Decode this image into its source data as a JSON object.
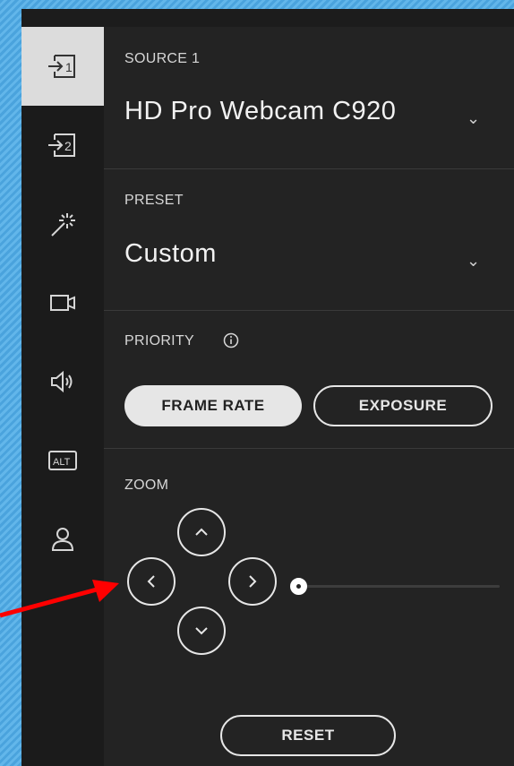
{
  "sidebar": {
    "items": [
      {
        "icon": "source-1-icon",
        "active": true,
        "text": "1"
      },
      {
        "icon": "source-2-icon",
        "active": false,
        "text": "2"
      },
      {
        "icon": "magic-wand-icon",
        "active": false
      },
      {
        "icon": "camera-icon",
        "active": false
      },
      {
        "icon": "speaker-icon",
        "active": false
      },
      {
        "icon": "alt-icon",
        "active": false,
        "text": "ALT"
      },
      {
        "icon": "user-icon",
        "active": false
      }
    ]
  },
  "source": {
    "label": "SOURCE 1",
    "value": "HD Pro Webcam C920"
  },
  "preset": {
    "label": "PRESET",
    "value": "Custom"
  },
  "priority": {
    "label": "PRIORITY",
    "info_icon": "info-icon",
    "options": [
      "FRAME RATE",
      "EXPOSURE"
    ],
    "selected": "FRAME RATE"
  },
  "zoom": {
    "label": "ZOOM",
    "level": 0
  },
  "reset_label": "RESET",
  "colors": {
    "panel_bg": "#232323",
    "sidebar_bg": "#1b1b1b",
    "active_nav_bg": "#dcdcdc",
    "arrow_annotation": "#ff0000",
    "background_stripes": "#4aa3dd"
  }
}
